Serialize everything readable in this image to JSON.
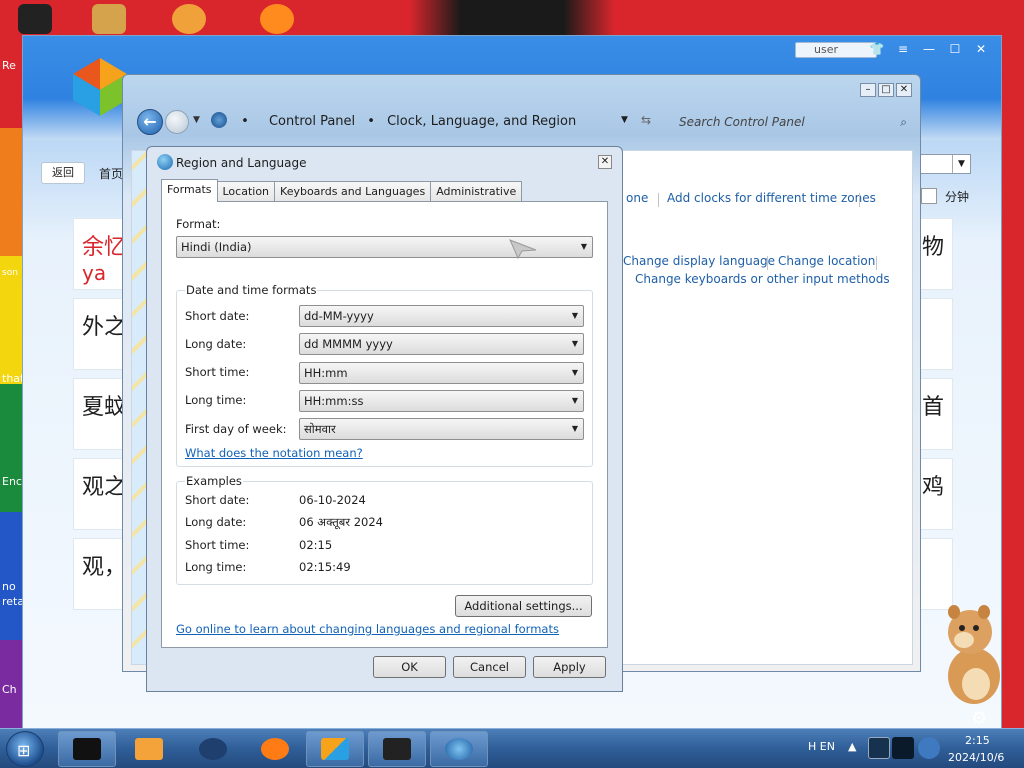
{
  "desktop": {
    "labels": [
      "Re",
      "son",
      "that",
      "Enc",
      "no",
      "reta",
      "Ch"
    ]
  },
  "browser": {
    "user_label": "user",
    "back_label": "返回",
    "home_label": "首页",
    "right_label": "分钟",
    "cards": [
      {
        "left": "余忆",
        "left2": "ya",
        "right": "物"
      },
      {
        "left": "外之",
        "right": ""
      },
      {
        "left": "夏蚊",
        "right": "首"
      },
      {
        "left": "观之",
        "right": "鸡"
      },
      {
        "left": "观，",
        "right": ""
      }
    ]
  },
  "control_panel": {
    "address": {
      "crumb1": "Control Panel",
      "crumb2": "Clock, Language, and Region"
    },
    "search_placeholder": "Search Control Panel",
    "links": {
      "timezone_tail": "one",
      "add_clocks": "Add clocks for different time zones",
      "display_language": "Change display language",
      "location": "Change location",
      "keyboards": "Change keyboards or other input methods"
    }
  },
  "dialog": {
    "title": "Region and Language",
    "tabs": [
      "Formats",
      "Location",
      "Keyboards and Languages",
      "Administrative"
    ],
    "format_label": "Format:",
    "format_value": "Hindi (India)",
    "date_time_group": "Date and time formats",
    "fields": [
      {
        "label": "Short date:",
        "value": "dd-MM-yyyy"
      },
      {
        "label": "Long date:",
        "value": "dd MMMM yyyy"
      },
      {
        "label": "Short time:",
        "value": "HH:mm"
      },
      {
        "label": "Long time:",
        "value": "HH:mm:ss"
      },
      {
        "label": "First day of week:",
        "value": "सोमवार"
      }
    ],
    "notation_link": "What does the notation mean?",
    "examples_group": "Examples",
    "examples": [
      {
        "label": "Short date:",
        "value": "06-10-2024"
      },
      {
        "label": "Long date:",
        "value": "06 अक्तूबर 2024"
      },
      {
        "label": "Short time:",
        "value": "02:15"
      },
      {
        "label": "Long time:",
        "value": "02:15:49"
      }
    ],
    "additional_button": "Additional settings...",
    "online_link": "Go online to learn about changing languages and regional formats",
    "ok": "OK",
    "cancel": "Cancel",
    "apply": "Apply"
  },
  "taskbar": {
    "lang": "H EN",
    "time": "2:15",
    "date": "2024/10/6"
  },
  "colors": {
    "link": "#1162b8",
    "taskbar": "#2f5e98",
    "desktop_red": "#d8262c"
  }
}
